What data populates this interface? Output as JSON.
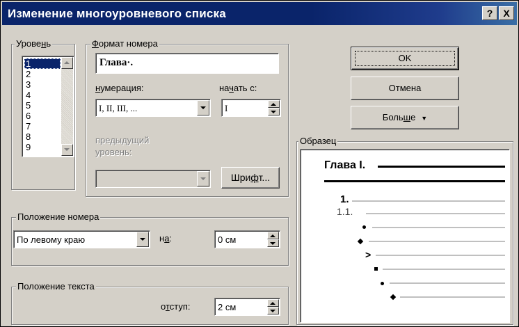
{
  "window": {
    "title": "Изменение многоуровневого списка",
    "help_label": "?",
    "close_label": "X"
  },
  "level": {
    "legend_pre": "Урове",
    "legend_ul": "н",
    "legend_post": "ь",
    "items": [
      "1",
      "2",
      "3",
      "4",
      "5",
      "6",
      "7",
      "8",
      "9"
    ],
    "selected": "1"
  },
  "number_format": {
    "legend_pre": "",
    "legend_ul": "Ф",
    "legend_post": "ормат номера",
    "value": "Глава·.",
    "numbering_label_ul": "н",
    "numbering_label_post": "умерация:",
    "numbering_value": "I, II, III, ...",
    "start_label_pre": "на",
    "start_label_ul": "ч",
    "start_label_post": "ать с:",
    "start_value": "I",
    "prev_level_label": "предыдущий уровень:",
    "prev_level_value": "",
    "font_button_pre": "Шри",
    "font_button_ul": "ф",
    "font_button_post": "т..."
  },
  "buttons": {
    "ok": "OK",
    "cancel": "Отмена",
    "more_pre": "Боль",
    "more_ul": "ш",
    "more_post": "е",
    "more_arrow": "▼"
  },
  "sample": {
    "legend": "Образец",
    "heading": "Глава I.",
    "line1": "1.",
    "line2": "1.1."
  },
  "number_position": {
    "legend": "Положение номера",
    "alignment_value": "По левому краю",
    "at_label_pre": "н",
    "at_label_ul": "а",
    "at_label_post": ":",
    "at_value": "0 см"
  },
  "text_position": {
    "legend": "Положение текста",
    "indent_label_pre": "о",
    "indent_label_ul": "т",
    "indent_label_post": "ступ:",
    "indent_value": "2 см"
  }
}
